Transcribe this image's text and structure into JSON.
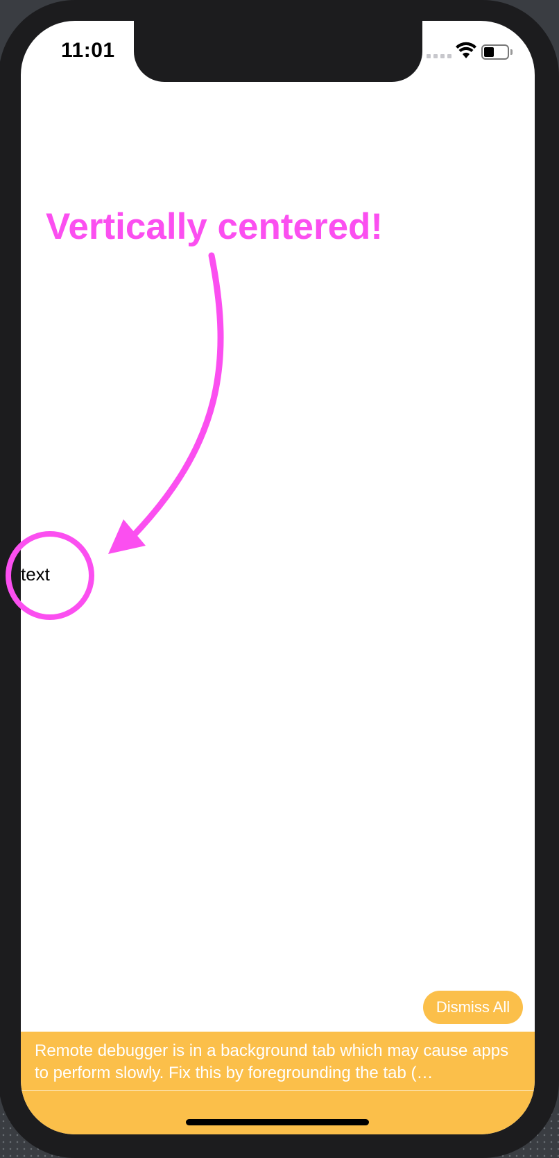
{
  "status_bar": {
    "time": "11:01",
    "signal_icon": "cellular-signal-icon",
    "wifi_icon": "wifi-icon",
    "battery_icon": "battery-icon",
    "battery_level": 0.4
  },
  "annotation": {
    "title": "Vertically centered!",
    "color": "#fb4ff0",
    "arrow_icon": "curved-arrow-icon",
    "circle_icon": "circle-highlight-icon"
  },
  "content": {
    "label": "text"
  },
  "dev_warning": {
    "dismiss_label": "Dismiss All",
    "message": "Remote debugger is in a background tab which may cause apps to perform slowly. Fix this by foregrounding the tab (…",
    "accent": "#fbbf4a"
  }
}
